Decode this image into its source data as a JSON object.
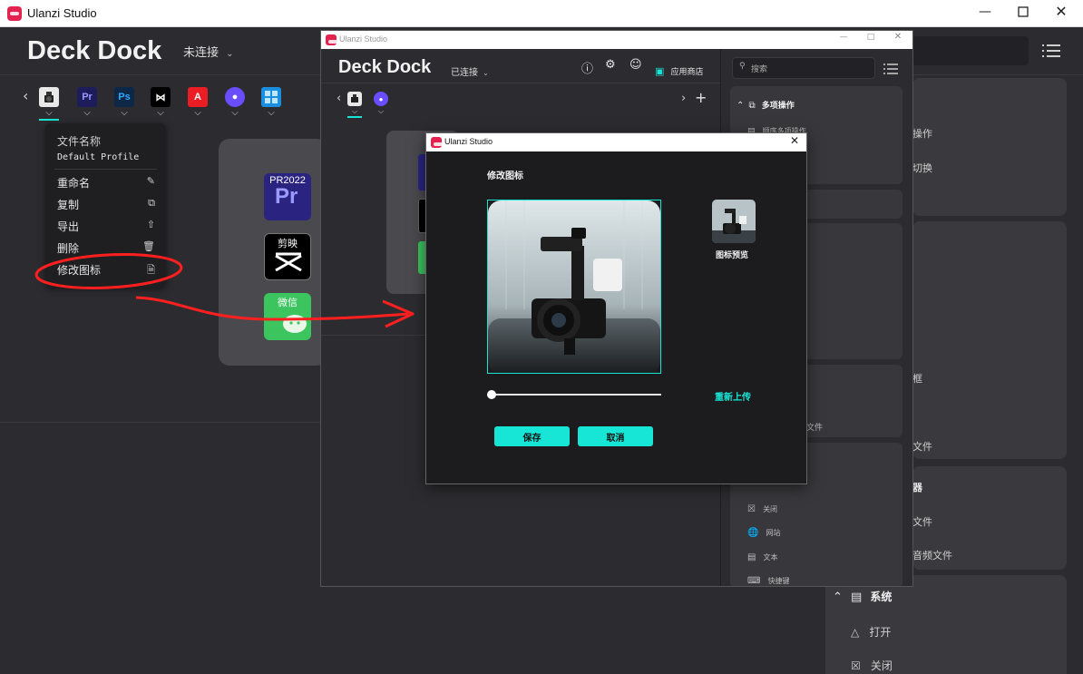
{
  "main_window": {
    "title": "Ulanzi Studio",
    "deck_title": "Deck Dock",
    "connection_status": "未连接",
    "context_menu": {
      "header_label": "文件名称",
      "profile_name": "Default Profile",
      "items": [
        "重命名",
        "复制",
        "导出",
        "删除",
        "修改图标"
      ]
    },
    "deck_keys": [
      {
        "label": "PR2022",
        "icon": "premiere-icon"
      },
      {
        "label": "剪映",
        "icon": "capcut-icon"
      },
      {
        "label": "微信",
        "icon": "wechat-icon"
      }
    ],
    "side_fragments": [
      "操作",
      "切换",
      "框",
      "文件",
      "器",
      "文件",
      "音频文件"
    ],
    "system_section": {
      "title": "系统",
      "items": [
        "打开",
        "关闭"
      ]
    }
  },
  "second_window": {
    "title": "Ulanzi Studio",
    "deck_title": "Deck Dock",
    "connection_status": "已连接",
    "app_store_label": "应用商店",
    "search_placeholder": "搜索",
    "multi_action": {
      "title": "多项操作",
      "item": "顺序多项操作"
    },
    "side_fragment": "文件",
    "action_items": [
      "关闭",
      "网站",
      "文本",
      "快捷键"
    ]
  },
  "dialog": {
    "title": "Ulanzi Studio",
    "heading": "修改图标",
    "preview_label": "图标预览",
    "reupload_label": "重新上传",
    "save_label": "保存",
    "cancel_label": "取消",
    "zoom_slider_value": 0,
    "accent_color": "#17e6d6"
  }
}
